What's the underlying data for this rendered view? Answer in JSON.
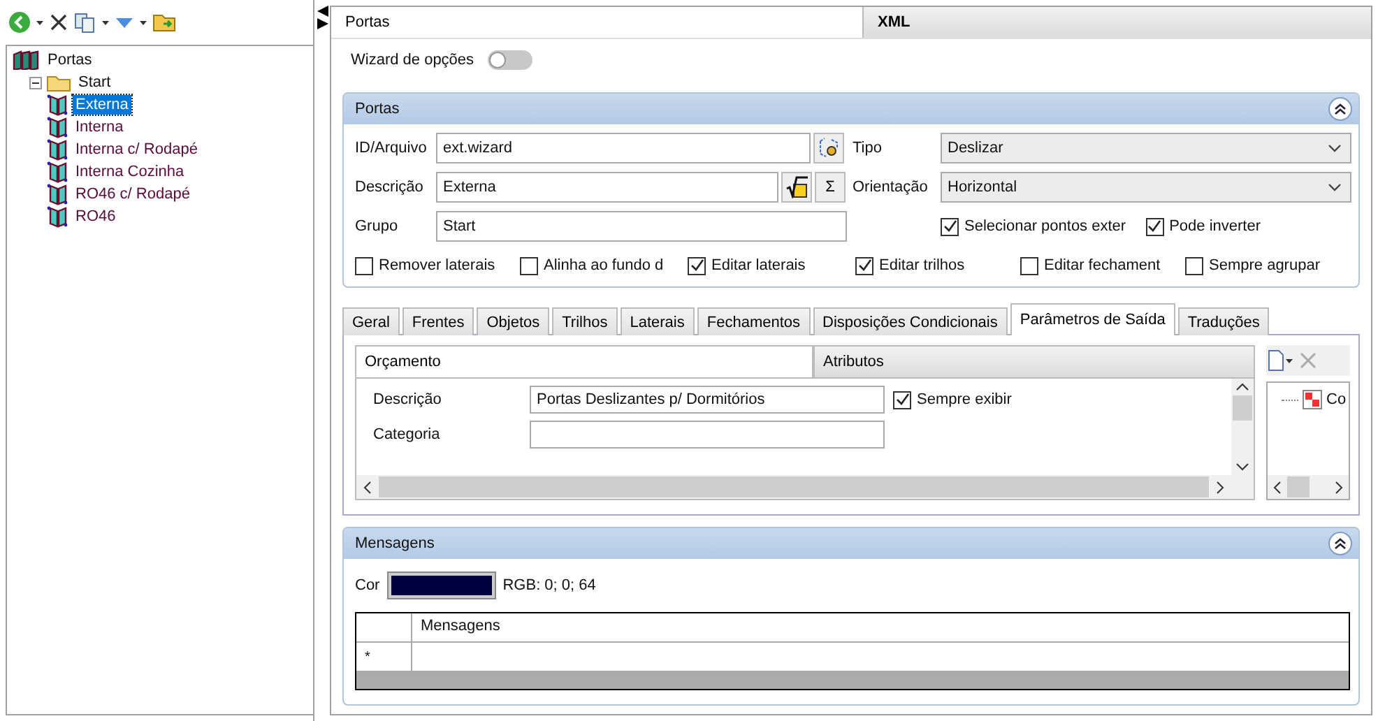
{
  "tree": [
    {
      "label": "Portas",
      "kind": "root",
      "children": [
        {
          "label": "Start",
          "kind": "folder",
          "expanded": true,
          "children": [
            {
              "label": "Externa",
              "kind": "door",
              "selected": true
            },
            {
              "label": "Interna",
              "kind": "door",
              "selected": false
            },
            {
              "label": "Interna c/ Rodapé",
              "kind": "door",
              "selected": false
            },
            {
              "label": "Interna Cozinha",
              "kind": "door",
              "selected": false
            },
            {
              "label": "RO46 c/ Rodapé",
              "kind": "door",
              "selected": false
            },
            {
              "label": "RO46",
              "kind": "door",
              "selected": false
            }
          ]
        }
      ]
    }
  ],
  "main_tabs": [
    {
      "label": "Portas",
      "selected": true
    },
    {
      "label": "XML",
      "selected": false
    }
  ],
  "wizard": {
    "label": "Wizard de opções",
    "on": false
  },
  "portas": {
    "title": "Portas",
    "id_label": "ID/Arquivo",
    "id_value": "ext.wizard",
    "descricao_label": "Descrição",
    "descricao_value": "Externa",
    "sum_button": "Σ",
    "grupo_label": "Grupo",
    "grupo_value": "Start",
    "tipo_label": "Tipo",
    "tipo_value": "Deslizar",
    "orientacao_label": "Orientação",
    "orientacao_value": "Horizontal",
    "right_options": [
      {
        "label": "Selecionar pontos exter",
        "checked": true
      },
      {
        "label": "Pode inverter",
        "checked": true
      }
    ],
    "options": [
      {
        "label": "Remover laterais",
        "checked": false
      },
      {
        "label": "Alinha ao fundo d",
        "checked": false
      },
      {
        "label": "Editar laterais",
        "checked": true
      },
      {
        "label": "Editar trilhos",
        "checked": true
      },
      {
        "label": "Editar fechament",
        "checked": false
      },
      {
        "label": "Sempre agrupar",
        "checked": false
      }
    ]
  },
  "detail_tabs": [
    {
      "label": "Geral",
      "selected": false
    },
    {
      "label": "Frentes",
      "selected": false
    },
    {
      "label": "Objetos",
      "selected": false
    },
    {
      "label": "Trilhos",
      "selected": false
    },
    {
      "label": "Laterais",
      "selected": false
    },
    {
      "label": "Fechamentos",
      "selected": false
    },
    {
      "label": "Disposições Condicionais",
      "selected": false
    },
    {
      "label": "Parâmetros de Saída",
      "selected": true
    },
    {
      "label": "Traduções",
      "selected": false
    }
  ],
  "sub_tabs": [
    {
      "label": "Orçamento",
      "selected": true
    },
    {
      "label": "Atributos",
      "selected": false
    }
  ],
  "output_rows": [
    {
      "label": "Descrição",
      "value": "Portas Deslizantes p/ Dormitórios",
      "always_show": {
        "label": "Sempre exibir",
        "checked": true
      }
    },
    {
      "label": "Categoria"
    }
  ],
  "side_tree": [
    {
      "label": "Co"
    }
  ],
  "mensagens": {
    "title": "Mensagens",
    "color_label": "Cor",
    "color": "#000040",
    "rgb_text": "RGB: 0; 0; 64",
    "columns": [
      "Mensagens"
    ],
    "new_row_marker": "*"
  }
}
